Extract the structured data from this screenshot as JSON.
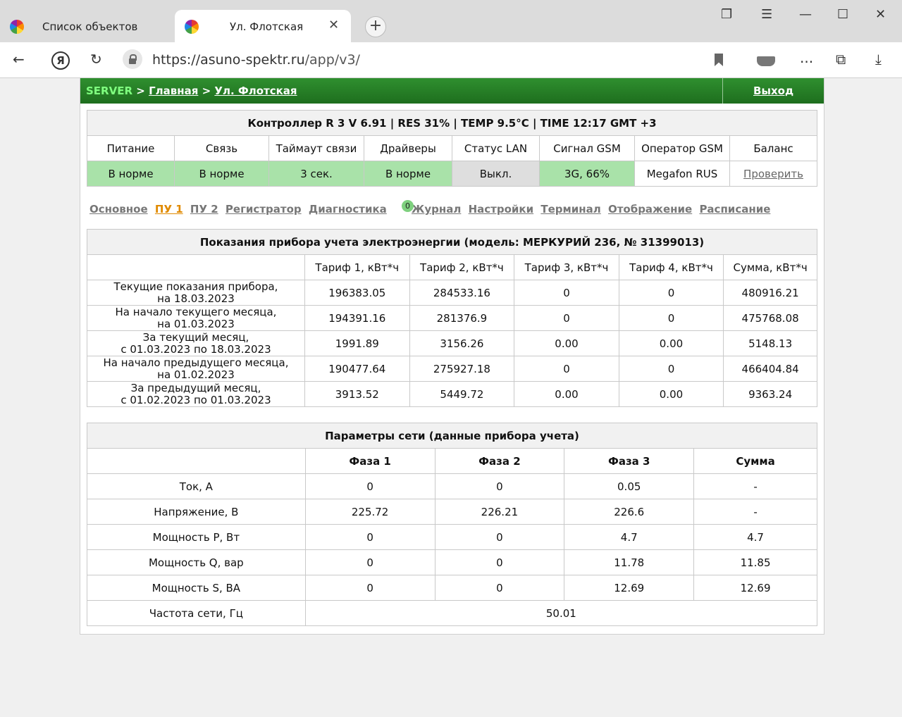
{
  "browser": {
    "tabs": [
      {
        "label": "Список объектов",
        "active": false
      },
      {
        "label": "Ул. Флотская",
        "active": true
      }
    ],
    "url_host": "https://asuno-spektr.ru",
    "url_path": "/app/v3/",
    "more_label": "..."
  },
  "header": {
    "server": "SERVER",
    "arrow": ">",
    "home": "Главная",
    "object": "Ул. Флотская",
    "logout": "Выход"
  },
  "status": {
    "title": "Контроллер R 3 V 6.91 | RES 31% | TEMP 9.5°C | TIME 12:17 GMT +3",
    "columns": [
      "Питание",
      "Связь",
      "Таймаут связи",
      "Драйверы",
      "Статус LAN",
      "Сигнал GSM",
      "Оператор GSM",
      "Баланс"
    ],
    "values": [
      "В норме",
      "В норме",
      "3 сек.",
      "В норме",
      "Выкл.",
      "3G, 66%",
      "Megafon RUS",
      "Проверить"
    ]
  },
  "subnav": {
    "items": [
      "Основное",
      "ПУ 1",
      "ПУ 2",
      "Регистратор",
      "Диагностика",
      "Журнал",
      "Настройки",
      "Терминал",
      "Отображение",
      "Расписание"
    ],
    "active": "ПУ 1",
    "diag_badge": "0"
  },
  "meter": {
    "title": "Показания прибора учета электроэнергии (модель: МЕРКУРИЙ 236, № 31399013)",
    "headers": [
      "",
      "Тариф 1, кВт*ч",
      "Тариф 2, кВт*ч",
      "Тариф 3, кВт*ч",
      "Тариф 4, кВт*ч",
      "Сумма, кВт*ч"
    ],
    "rows": [
      {
        "l1": "Текущие показания прибора,",
        "l2": "на 18.03.2023",
        "v": [
          "196383.05",
          "284533.16",
          "0",
          "0",
          "480916.21"
        ]
      },
      {
        "l1": "На начало текущего месяца,",
        "l2": "на 01.03.2023",
        "v": [
          "194391.16",
          "281376.9",
          "0",
          "0",
          "475768.08"
        ]
      },
      {
        "l1": "За текущий месяц,",
        "l2": "с 01.03.2023 по 18.03.2023",
        "v": [
          "1991.89",
          "3156.26",
          "0.00",
          "0.00",
          "5148.13"
        ]
      },
      {
        "l1": "На начало предыдущего месяца,",
        "l2": "на 01.02.2023",
        "v": [
          "190477.64",
          "275927.18",
          "0",
          "0",
          "466404.84"
        ]
      },
      {
        "l1": "За предыдущий месяц,",
        "l2": "с 01.02.2023 по 01.03.2023",
        "v": [
          "3913.52",
          "5449.72",
          "0.00",
          "0.00",
          "9363.24"
        ]
      }
    ]
  },
  "network": {
    "title": "Параметры сети (данные прибора учета)",
    "headers": [
      "",
      "Фаза 1",
      "Фаза 2",
      "Фаза 3",
      "Сумма"
    ],
    "rows": [
      {
        "label": "Ток, А",
        "v": [
          "0",
          "0",
          "0.05",
          "-"
        ]
      },
      {
        "label": "Напряжение, В",
        "v": [
          "225.72",
          "226.21",
          "226.6",
          "-"
        ]
      },
      {
        "label": "Мощность P, Вт",
        "v": [
          "0",
          "0",
          "4.7",
          "4.7"
        ]
      },
      {
        "label": "Мощность Q, вар",
        "v": [
          "0",
          "0",
          "11.78",
          "11.85"
        ]
      },
      {
        "label": "Мощность S, ВА",
        "v": [
          "0",
          "0",
          "12.69",
          "12.69"
        ]
      }
    ],
    "freq_label": "Частота сети, Гц",
    "freq_value": "50.01"
  }
}
